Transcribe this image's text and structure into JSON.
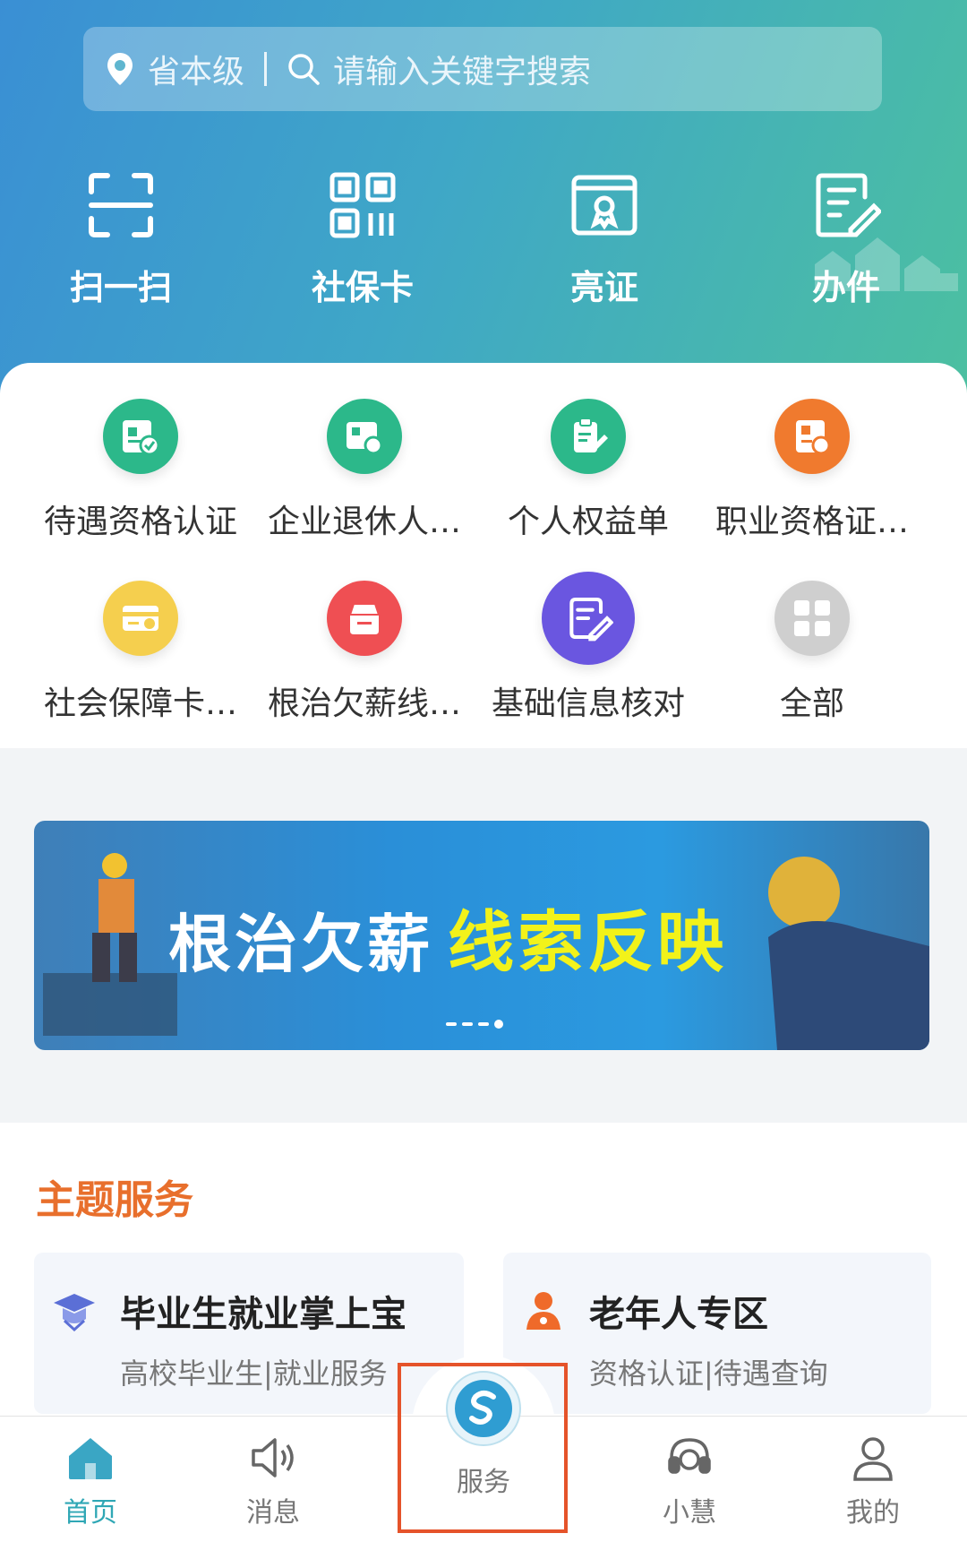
{
  "header": {
    "location": "省本级",
    "search_placeholder": "请输入关键字搜索"
  },
  "quick_actions": [
    {
      "label": "扫一扫",
      "icon": "scan-icon"
    },
    {
      "label": "社保卡",
      "icon": "qr-code-icon"
    },
    {
      "label": "亮证",
      "icon": "certificate-icon"
    },
    {
      "label": "办件",
      "icon": "edit-document-icon"
    }
  ],
  "services": [
    {
      "label": "待遇资格认证",
      "icon": "id-check-icon",
      "color": "#2cb88a"
    },
    {
      "label": "企业退休人…",
      "icon": "id-search-icon",
      "color": "#2cb88a"
    },
    {
      "label": "个人权益单",
      "icon": "clipboard-edit-icon",
      "color": "#2cb88a"
    },
    {
      "label": "职业资格证…",
      "icon": "certificate-search-icon",
      "color": "#f07a2e"
    },
    {
      "label": "社会保障卡…",
      "icon": "card-check-icon",
      "color": "#f5cf4e"
    },
    {
      "label": "根治欠薪线…",
      "icon": "mailbox-icon",
      "color": "#ef4f53"
    },
    {
      "label": "基础信息核对",
      "icon": "document-edit-icon",
      "color": "#6a56e0"
    },
    {
      "label": "全部",
      "icon": "grid-icon",
      "color": "#cfcfcf"
    }
  ],
  "banner": {
    "text_white": "根治欠薪",
    "text_yellow": "线索反映"
  },
  "theme": {
    "title": "主题服务",
    "cards": [
      {
        "title": "毕业生就业掌上宝",
        "subtitle": "高校毕业生|就业服务",
        "icon": "graduation-cap-icon"
      },
      {
        "title": "老年人专区",
        "subtitle": "资格认证|待遇查询",
        "icon": "elder-person-icon"
      }
    ]
  },
  "tabbar": {
    "items": [
      {
        "label": "首页",
        "icon": "home-icon",
        "active": true
      },
      {
        "label": "消息",
        "icon": "speaker-icon"
      },
      {
        "label": "服务",
        "icon": "service-logo-icon"
      },
      {
        "label": "小慧",
        "icon": "headset-icon"
      },
      {
        "label": "我的",
        "icon": "user-icon"
      }
    ]
  },
  "colors": {
    "accent": "#2fa7b5",
    "theme_title": "#e86f2c",
    "highlight_box": "#e5532a"
  }
}
